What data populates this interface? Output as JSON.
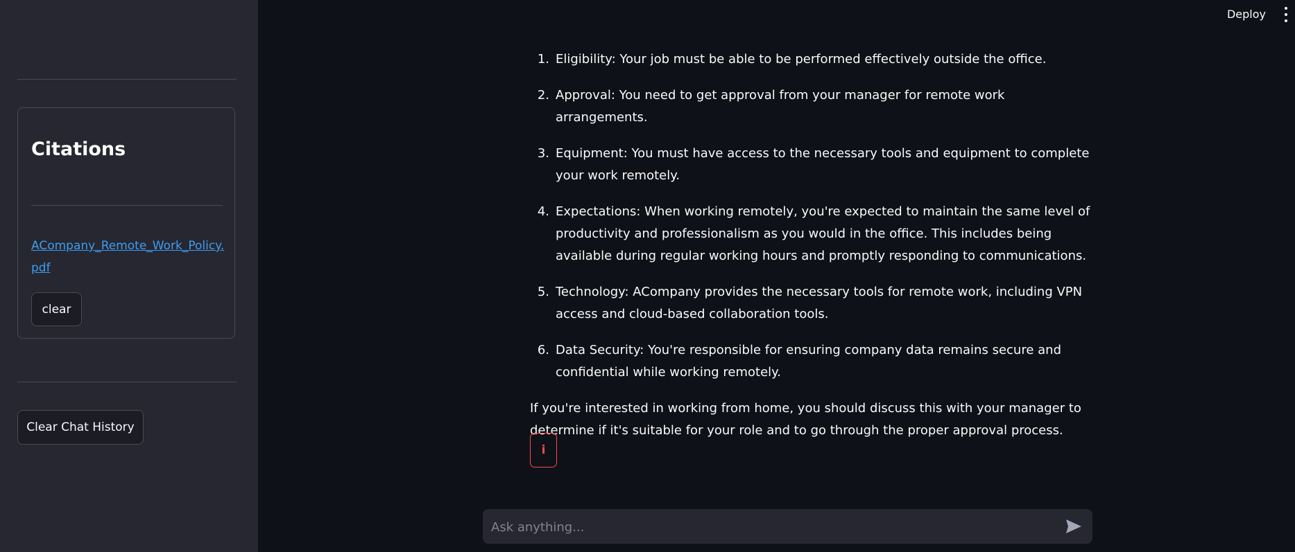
{
  "header": {
    "deploy_label": "Deploy",
    "menu_icon": "kebab-menu-icon"
  },
  "sidebar": {
    "citations_title": "Citations",
    "citation_link": "ACompany_Remote_Work_Policy.pdf",
    "clear_label": "clear",
    "clear_history_label": "Clear Chat History"
  },
  "chat": {
    "items": [
      {
        "num": "1.",
        "text": "Eligibility: Your job must be able to be performed effectively outside the office."
      },
      {
        "num": "2.",
        "text": "Approval: You need to get approval from your manager for remote work arrangements."
      },
      {
        "num": "3.",
        "text": "Equipment: You must have access to the necessary tools and equipment to complete your work remotely."
      },
      {
        "num": "4.",
        "text": "Expectations: When working remotely, you're expected to maintain the same level of productivity and professionalism as you would in the office. This includes being available during regular working hours and promptly responding to communications."
      },
      {
        "num": "5.",
        "text": "Technology: ACompany provides the necessary tools for remote work, including VPN access and cloud-based collaboration tools."
      },
      {
        "num": "6.",
        "text": "Data Security: You're responsible for ensuring company data remains secure and confidential while working remotely."
      }
    ],
    "closing": "If you're interested in working from home, you should discuss this with your manager to determine if it's suitable for your role and to go through the proper approval process.",
    "info_label": "i",
    "info_icon": "info-icon"
  },
  "input": {
    "placeholder": "Ask anything...",
    "send_icon": "send-icon"
  },
  "colors": {
    "background": "#0e1117",
    "sidebar": "#262730",
    "link": "#3d9df3",
    "accent": "#ff4b4b"
  }
}
